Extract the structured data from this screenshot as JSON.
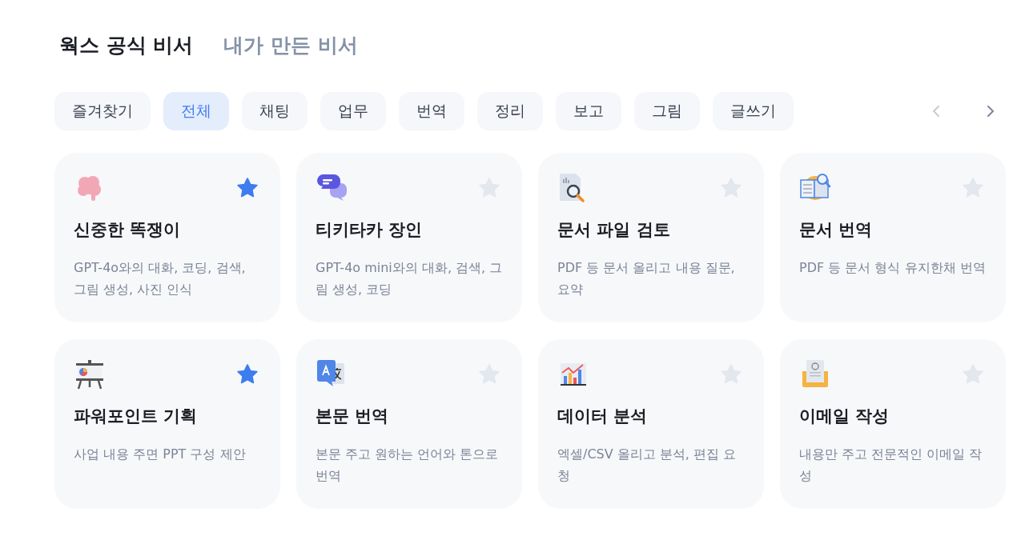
{
  "header_tabs": [
    {
      "label": "웍스 공식 비서",
      "selected": true
    },
    {
      "label": "내가 만든 비서",
      "selected": false
    }
  ],
  "categories": [
    {
      "label": "즐겨찾기",
      "selected": false
    },
    {
      "label": "전체",
      "selected": true
    },
    {
      "label": "채팅",
      "selected": false
    },
    {
      "label": "업무",
      "selected": false
    },
    {
      "label": "번역",
      "selected": false
    },
    {
      "label": "정리",
      "selected": false
    },
    {
      "label": "보고",
      "selected": false
    },
    {
      "label": "그림",
      "selected": false
    },
    {
      "label": "글쓰기",
      "selected": false
    }
  ],
  "nav": [
    {
      "kind": "prev",
      "disabled": true
    },
    {
      "kind": "next",
      "disabled": false
    }
  ],
  "assistants": [
    {
      "kind": "brain",
      "title": "신중한 똑쟁이",
      "description": "GPT-4o와의 대화, 코딩, 검색, 그림 생성, 사진 인식",
      "favorite": true
    },
    {
      "kind": "chat",
      "title": "티키타카 장인",
      "description": "GPT-4o mini와의 대화, 검색, 그림 생성, 코딩",
      "favorite": false
    },
    {
      "kind": "doc-search",
      "title": "문서 파일 검토",
      "description": "PDF 등 문서 올리고 내용 질문, 요약",
      "favorite": false
    },
    {
      "kind": "book",
      "title": "문서 번역",
      "description": "PDF 등 문서 형식 유지한채 번역",
      "favorite": false
    },
    {
      "kind": "presentation",
      "title": "파워포인트 기획",
      "description": "사업 내용 주면 PPT 구성 제안",
      "favorite": true
    },
    {
      "kind": "translate",
      "title": "본문 번역",
      "description": "본문 주고 원하는 언어와 톤으로 번역",
      "favorite": false
    },
    {
      "kind": "chart",
      "title": "데이터 분석",
      "description": "엑셀/CSV 올리고 분석, 편집 요청",
      "favorite": false
    },
    {
      "kind": "email",
      "title": "이메일 작성",
      "description": "내용만 주고 전문적인 이메일 작성",
      "favorite": false
    }
  ]
}
